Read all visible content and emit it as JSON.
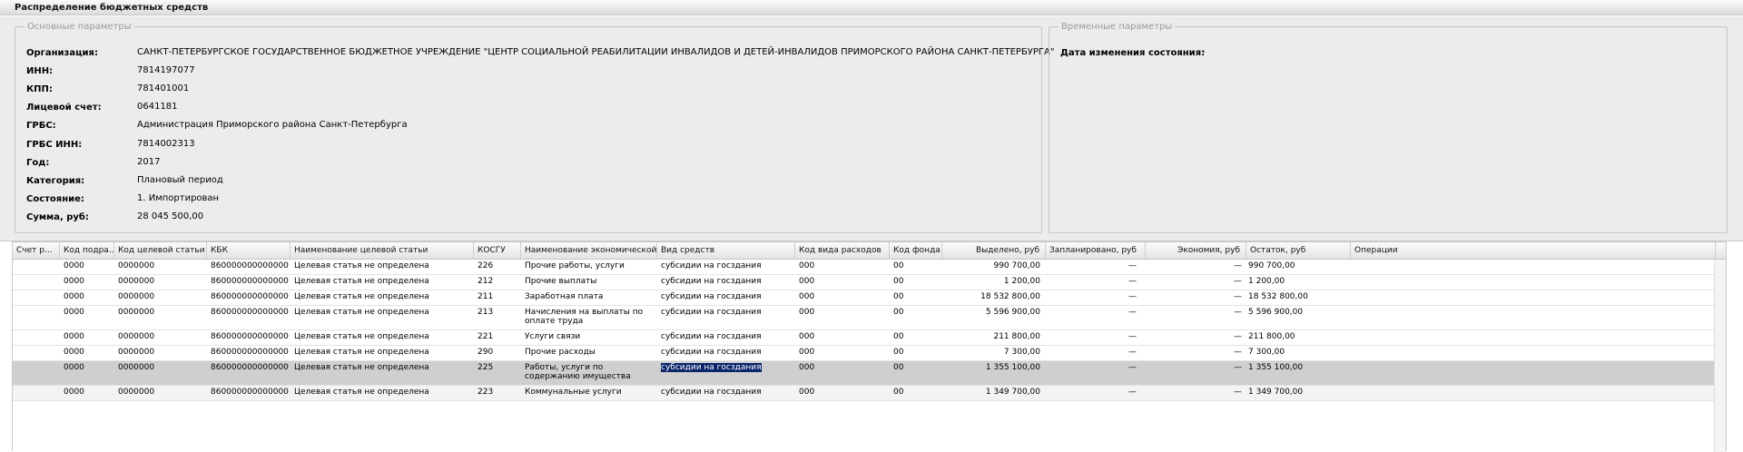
{
  "window": {
    "title": "Распределение бюджетных средств"
  },
  "main_group": {
    "legend": "Основные параметры",
    "fields": [
      {
        "label": "Организация:",
        "value": "САНКТ-ПЕТЕРБУРГСКОЕ ГОСУДАРСТВЕННОЕ БЮДЖЕТНОЕ УЧРЕЖДЕНИЕ \"ЦЕНТР СОЦИАЛЬНОЙ РЕАБИЛИТАЦИИ ИНВАЛИДОВ И ДЕТЕЙ-ИНВАЛИДОВ ПРИМОРСКОГО РАЙОНА САНКТ-ПЕТЕРБУРГА\""
      },
      {
        "label": "ИНН:",
        "value": "7814197077"
      },
      {
        "label": "КПП:",
        "value": "781401001"
      },
      {
        "label": "Лицевой счет:",
        "value": "0641181"
      },
      {
        "label": "ГРБС:",
        "value": "Администрация Приморского района Санкт-Петербурга"
      },
      {
        "label": "ГРБС ИНН:",
        "value": "7814002313"
      },
      {
        "label": "Год:",
        "value": "2017"
      },
      {
        "label": "Категория:",
        "value": "Плановый период"
      },
      {
        "label": "Состояние:",
        "value": "1. Импортирован"
      },
      {
        "label": "Сумма, руб:",
        "value": "28 045 500,00"
      }
    ]
  },
  "time_group": {
    "legend": "Временные параметры",
    "fields": [
      {
        "label": "Дата изменения состояния:",
        "value": "-"
      }
    ]
  },
  "grid": {
    "columns": [
      "Счет р...",
      "Код подра...",
      "Код целевой статьи",
      "КБК",
      "Наименование целевой статьи",
      "КОСГУ",
      "Наименование экономической ...",
      "Вид средств",
      "Код вида расходов",
      "Код фонда",
      "Выделено, руб",
      "Запланировано, руб",
      "Экономия, руб",
      "Остаток, руб",
      "Операции"
    ],
    "rows": [
      {
        "podr": "0000",
        "cel": "0000000",
        "kbk": "860000000000000...",
        "naim_cel": "Целевая статья не определена",
        "kosgu": "226",
        "naim_ek": "Прочие работы, услуги",
        "vid": "субсидии на госздания",
        "kvr": "000",
        "fond": "00",
        "vydeleno": "990 700,00",
        "zaplan": "—",
        "ekonom": "—",
        "ostatok": "990 700,00"
      },
      {
        "podr": "0000",
        "cel": "0000000",
        "kbk": "860000000000000...",
        "naim_cel": "Целевая статья не определена",
        "kosgu": "212",
        "naim_ek": "Прочие выплаты",
        "vid": "субсидии на госздания",
        "kvr": "000",
        "fond": "00",
        "vydeleno": "1 200,00",
        "zaplan": "—",
        "ekonom": "—",
        "ostatok": "1 200,00"
      },
      {
        "podr": "0000",
        "cel": "0000000",
        "kbk": "860000000000000...",
        "naim_cel": "Целевая статья не определена",
        "kosgu": "211",
        "naim_ek": "Заработная плата",
        "vid": "субсидии на госздания",
        "kvr": "000",
        "fond": "00",
        "vydeleno": "18 532 800,00",
        "zaplan": "—",
        "ekonom": "—",
        "ostatok": "18 532 800,00"
      },
      {
        "podr": "0000",
        "cel": "0000000",
        "kbk": "860000000000000...",
        "naim_cel": "Целевая статья не определена",
        "kosgu": "213",
        "naim_ek": "Начисления на выплаты по оплате труда",
        "vid": "субсидии на госздания",
        "kvr": "000",
        "fond": "00",
        "vydeleno": "5 596 900,00",
        "zaplan": "—",
        "ekonom": "—",
        "ostatok": "5 596 900,00"
      },
      {
        "podr": "0000",
        "cel": "0000000",
        "kbk": "860000000000000...",
        "naim_cel": "Целевая статья не определена",
        "kosgu": "221",
        "naim_ek": "Услуги связи",
        "vid": "субсидии на госздания",
        "kvr": "000",
        "fond": "00",
        "vydeleno": "211 800,00",
        "zaplan": "—",
        "ekonom": "—",
        "ostatok": "211 800,00"
      },
      {
        "podr": "0000",
        "cel": "0000000",
        "kbk": "860000000000000...",
        "naim_cel": "Целевая статья не определена",
        "kosgu": "290",
        "naim_ek": "Прочие расходы",
        "vid": "субсидии на госздания",
        "kvr": "000",
        "fond": "00",
        "vydeleno": "7 300,00",
        "zaplan": "—",
        "ekonom": "—",
        "ostatok": "7 300,00"
      },
      {
        "podr": "0000",
        "cel": "0000000",
        "kbk": "860000000000000...",
        "naim_cel": "Целевая статья не определена",
        "kosgu": "225",
        "naim_ek": "Работы, услуги по содержанию имущества",
        "vid": "субсидии на госздания",
        "kvr": "000",
        "fond": "00",
        "vydeleno": "1 355 100,00",
        "zaplan": "—",
        "ekonom": "—",
        "ostatok": "1 355 100,00"
      },
      {
        "podr": "0000",
        "cel": "0000000",
        "kbk": "860000000000000...",
        "naim_cel": "Целевая статья не определена",
        "kosgu": "223",
        "naim_ek": "Коммунальные услуги",
        "vid": "субсидии на госздания",
        "kvr": "000",
        "fond": "00",
        "vydeleno": "1 349 700,00",
        "zaplan": "—",
        "ekonom": "—",
        "ostatok": "1 349 700,00"
      }
    ],
    "selected_row": 6
  }
}
